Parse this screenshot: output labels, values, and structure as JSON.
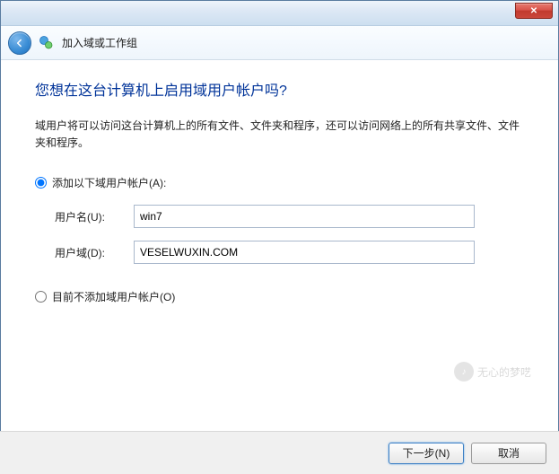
{
  "titlebar": {
    "close_glyph": "✕"
  },
  "header": {
    "title": "加入域或工作组"
  },
  "main": {
    "heading": "您想在这台计算机上启用域用户帐户吗?",
    "description": "域用户将可以访问这台计算机上的所有文件、文件夹和程序，还可以访问网络上的所有共享文件、文件夹和程序。",
    "option_add_label": "添加以下域用户帐户(A):",
    "option_skip_label": "目前不添加域用户帐户(O)",
    "username_label": "用户名(U):",
    "username_value": "win7",
    "domain_label": "用户域(D):",
    "domain_value": "VESELWUXIN.COM",
    "selected_option": "add"
  },
  "footer": {
    "next_label": "下一步(N)",
    "cancel_label": "取消"
  },
  "watermark": {
    "text": "无心的梦呓"
  }
}
